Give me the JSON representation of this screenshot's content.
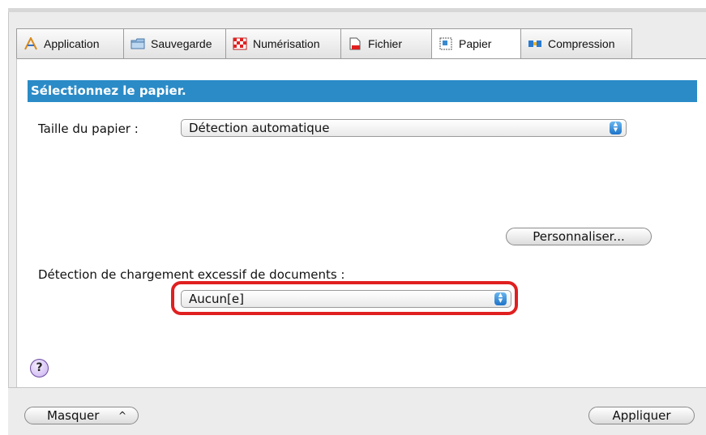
{
  "tabs": [
    {
      "label": "Application",
      "icon": "application-icon"
    },
    {
      "label": "Sauvegarde",
      "icon": "folder-icon"
    },
    {
      "label": "Numérisation",
      "icon": "scan-icon"
    },
    {
      "label": "Fichier",
      "icon": "file-icon"
    },
    {
      "label": "Papier",
      "icon": "paper-icon",
      "active": true
    },
    {
      "label": "Compression",
      "icon": "compression-icon"
    }
  ],
  "section": {
    "title": "Sélectionnez le papier."
  },
  "paper_size": {
    "label": "Taille du papier :",
    "value": "Détection automatique"
  },
  "customize_button": "Personnaliser...",
  "overload": {
    "label": "Détection de chargement excessif de documents :",
    "value": "Aucun[e]"
  },
  "help_symbol": "?",
  "footer": {
    "hide_button": "Masquer",
    "hide_chevron": "^",
    "apply_button": "Appliquer"
  },
  "colors": {
    "header_bg": "#2a8bc7",
    "highlight": "#e02020"
  }
}
